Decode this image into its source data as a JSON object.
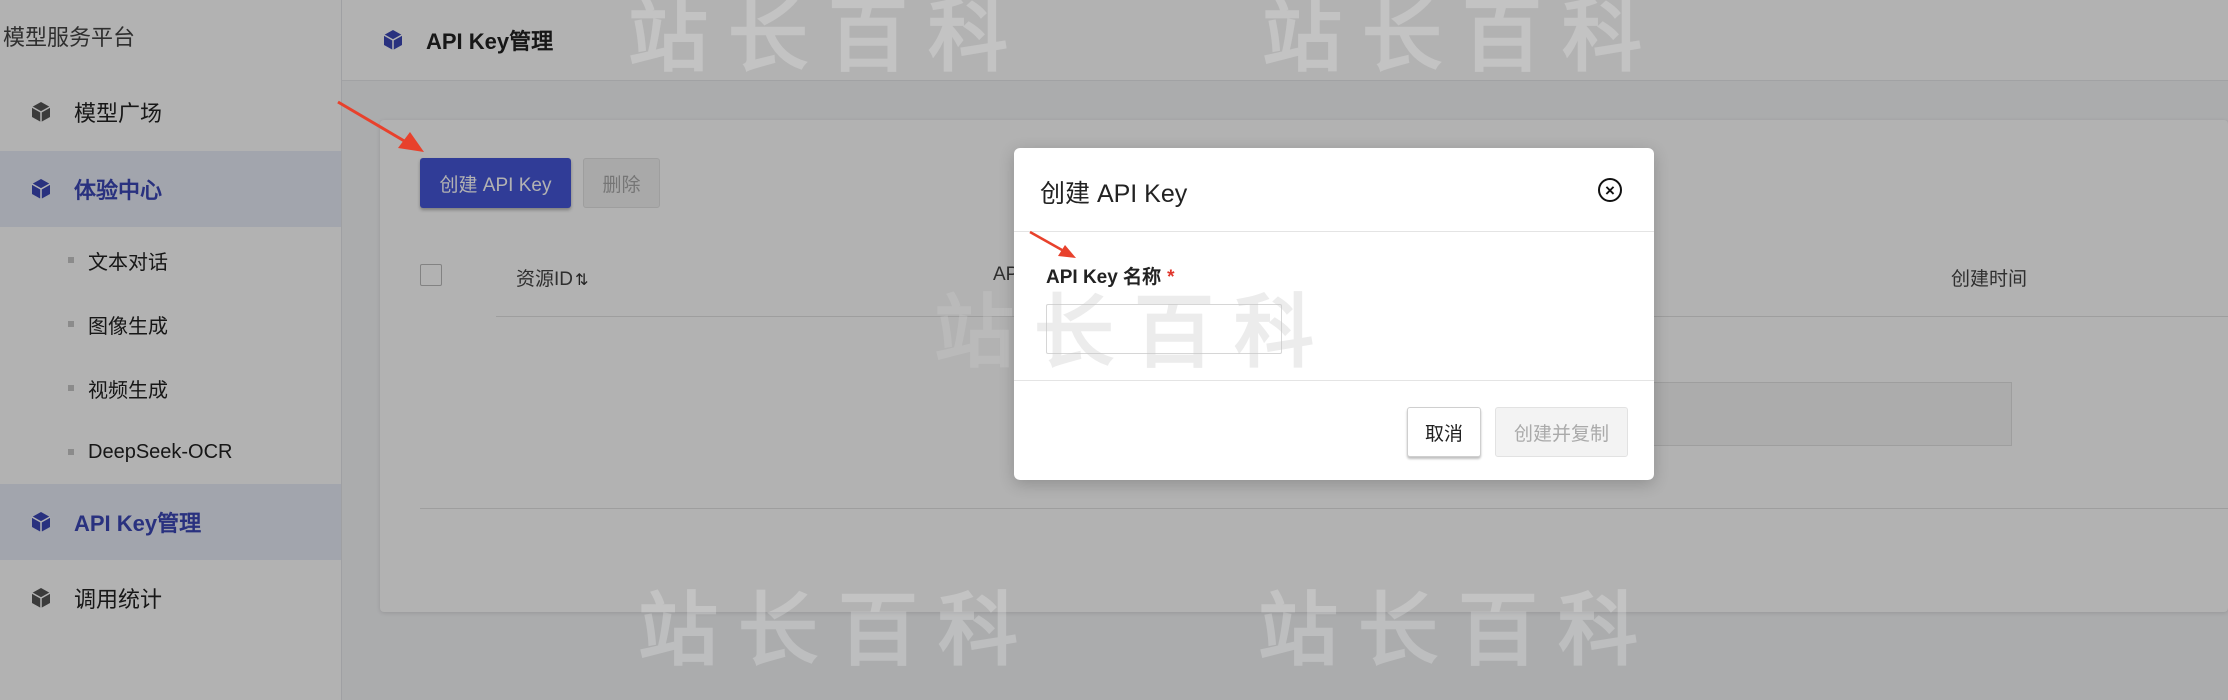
{
  "sidebar": {
    "brand": "模型服务平台",
    "items": [
      {
        "label": "模型广场",
        "icon": "cube-icon"
      },
      {
        "label": "体验中心",
        "icon": "cube-icon",
        "active": true
      },
      {
        "label": "API Key管理",
        "icon": "cube-icon",
        "active": true
      },
      {
        "label": "调用统计",
        "icon": "cube-icon"
      }
    ],
    "sub_items": [
      {
        "label": "文本对话"
      },
      {
        "label": "图像生成"
      },
      {
        "label": "视频生成"
      },
      {
        "label": "DeepSeek-OCR"
      }
    ]
  },
  "header": {
    "title": "API Key管理",
    "icon": "cube-icon"
  },
  "toolbar": {
    "create_label": "创建 API Key",
    "delete_label": "删除"
  },
  "table": {
    "columns": [
      "资源ID",
      "AP",
      "创建时间"
    ],
    "sort_icon": "⇅"
  },
  "watermark": {
    "text": "站长百科"
  },
  "modal": {
    "title": "创建 API Key",
    "field_label": "API Key 名称",
    "required_mark": "*",
    "input_value": "",
    "cancel_label": "取消",
    "confirm_label": "创建并复制"
  },
  "colors": {
    "accent": "#4656d9",
    "active_text": "#3b47b6",
    "active_bg": "#e9ecf8",
    "required": "#e0362c",
    "annotation_arrow": "#e8412c"
  }
}
